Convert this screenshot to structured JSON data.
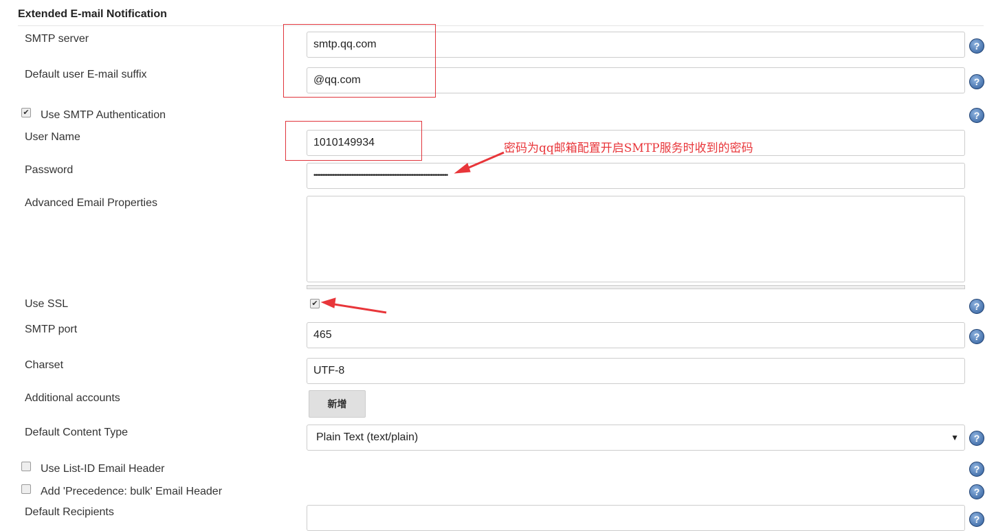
{
  "section_title": "Extended E-mail Notification",
  "fields": {
    "smtp_server": {
      "label": "SMTP server",
      "value": "smtp.qq.com"
    },
    "suffix": {
      "label": "Default user E-mail suffix",
      "value": "@qq.com"
    },
    "use_auth": {
      "label": "Use SMTP Authentication",
      "checked": true
    },
    "username": {
      "label": "User Name",
      "value": "1010149934"
    },
    "password": {
      "label": "Password",
      "value": "••••••••••••••••••••••••••••••••••••••••••••••••••••••••••••••••••••••••••••••"
    },
    "advanced": {
      "label": "Advanced Email Properties",
      "value": ""
    },
    "ssl": {
      "label": "Use SSL",
      "checked": true
    },
    "port": {
      "label": "SMTP port",
      "value": "465"
    },
    "charset": {
      "label": "Charset",
      "value": "UTF-8"
    },
    "accounts": {
      "label": "Additional accounts",
      "button": "新增"
    },
    "content_type": {
      "label": "Default Content Type",
      "value": "Plain Text (text/plain)"
    },
    "list_id": {
      "label": "Use List-ID Email Header",
      "checked": false
    },
    "precedence": {
      "label": "Add 'Precedence: bulk' Email Header",
      "checked": false
    },
    "recipients": {
      "label": "Default Recipients",
      "value": ""
    }
  },
  "annotation": "密码为qq邮箱配置开启SMTP服务时收到的密码",
  "help_icon": "?",
  "annotation_color": "#e8363a"
}
